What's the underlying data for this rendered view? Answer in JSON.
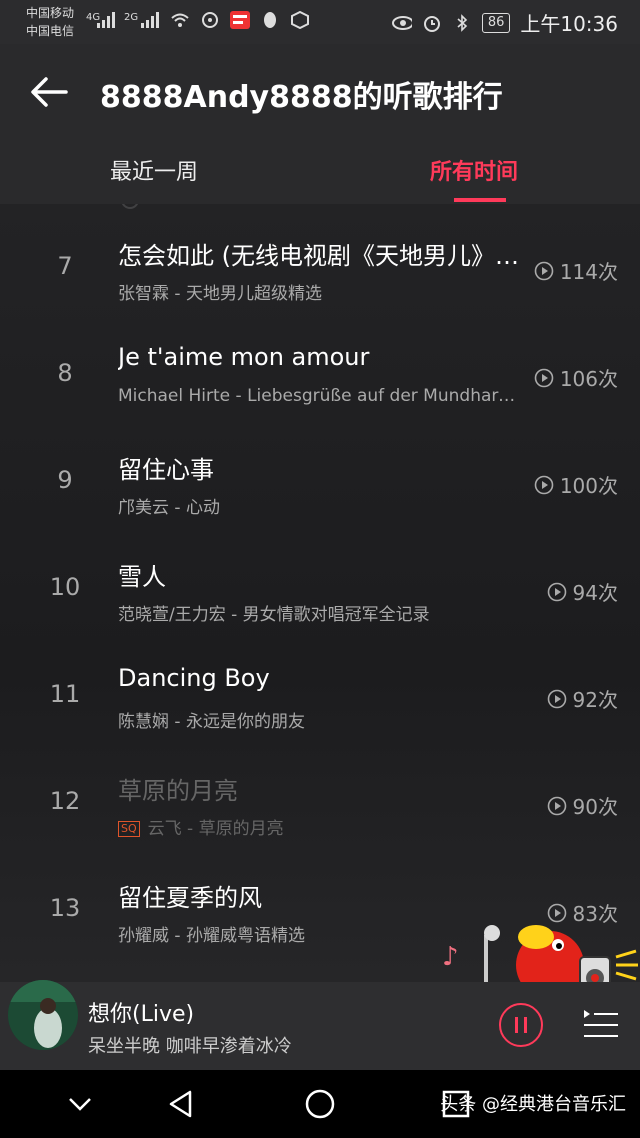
{
  "statusbar": {
    "carrier1": "中国移动",
    "carrier2": "中国电信",
    "net1": "4G",
    "net2": "2G",
    "battery": "86",
    "time": "上午10:36"
  },
  "header": {
    "title": "8888Andy8888的听歌排行",
    "tabs": [
      {
        "label": "最近一周",
        "active": false
      },
      {
        "label": "所有时间",
        "active": true
      }
    ]
  },
  "songs": [
    {
      "rank": "7",
      "title": "怎会如此 (无线电视剧《天地男儿》主题曲)",
      "artist_album": "张智霖 - 天地男儿超级精选",
      "plays": "114次",
      "dim": false
    },
    {
      "rank": "8",
      "title": "Je t'aime mon amour",
      "artist_album": "Michael Hirte - Liebesgrüße auf der Mundharmonika",
      "plays": "106次",
      "dim": false
    },
    {
      "rank": "9",
      "title": "留住心事",
      "artist_album": "邝美云 - 心动",
      "plays": "100次",
      "dim": false
    },
    {
      "rank": "10",
      "title": "雪人",
      "artist_album": "范晓萱/王力宏 - 男女情歌对唱冠军全记录",
      "plays": "94次",
      "dim": false
    },
    {
      "rank": "11",
      "title": "Dancing Boy",
      "artist_album": "陈慧娴 - 永远是你的朋友",
      "plays": "92次",
      "dim": false
    },
    {
      "rank": "12",
      "title": "草原的月亮",
      "artist_album": "云飞 - 草原的月亮",
      "plays": "90次",
      "dim": true,
      "badge": "SQ"
    },
    {
      "rank": "13",
      "title": "留住夏季的风",
      "artist_album": "孙耀威 - 孙耀威粤语精选",
      "plays": "83次",
      "dim": false
    }
  ],
  "player": {
    "title": "想你(Live)",
    "subtitle": "呆坐半晚 咖啡早渗着冰冷"
  },
  "watermark": "头条 @经典港台音乐汇",
  "colors": {
    "accent": "#ff3a5a",
    "background": "#1f1f21"
  },
  "icons": [
    "back-arrow-icon",
    "play-count-icon",
    "pause-icon",
    "playlist-icon",
    "nav-back-icon",
    "nav-home-icon",
    "nav-recent-icon",
    "nav-down-icon"
  ]
}
